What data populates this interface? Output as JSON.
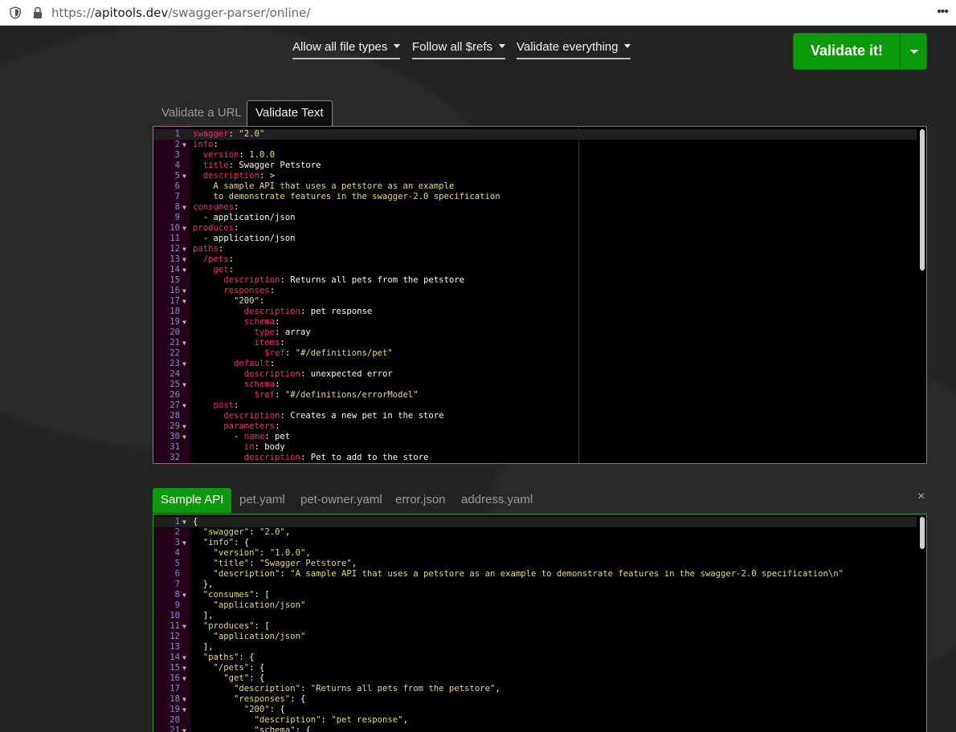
{
  "browser": {
    "url_scheme": "https://",
    "url_host": "apitools.dev",
    "url_path": "/swagger-parser/online/"
  },
  "options": {
    "file_types": "Allow all file types",
    "refs": "Follow all $refs",
    "validate": "Validate everything"
  },
  "validate_button": "Validate it!",
  "input_tabs": [
    "Validate a URL",
    "Validate Text"
  ],
  "output_tabs": [
    "Sample API",
    "pet.yaml",
    "pet-owner.yaml",
    "error.json",
    "address.yaml"
  ],
  "close_symbol": "×",
  "colors": {
    "accent_green": "#0d9a0d",
    "gutter": "#26001a",
    "key": "#f92672",
    "string": "#e6db74"
  },
  "yaml_lines": [
    {
      "n": "1",
      "fold": false,
      "segs": [
        [
          "k",
          "swagger"
        ],
        [
          "t",
          ": "
        ],
        [
          "s",
          "\"2.0\""
        ]
      ]
    },
    {
      "n": "2",
      "fold": true,
      "segs": [
        [
          "k",
          "info"
        ],
        [
          "t",
          ":"
        ]
      ]
    },
    {
      "n": "3",
      "fold": false,
      "segs": [
        [
          "t",
          "  "
        ],
        [
          "k",
          "version"
        ],
        [
          "t",
          ": "
        ],
        [
          "s",
          "1.0.0"
        ]
      ]
    },
    {
      "n": "4",
      "fold": false,
      "segs": [
        [
          "t",
          "  "
        ],
        [
          "k",
          "title"
        ],
        [
          "t",
          ": Swagger Petstore"
        ]
      ]
    },
    {
      "n": "5",
      "fold": true,
      "segs": [
        [
          "t",
          "  "
        ],
        [
          "k",
          "description"
        ],
        [
          "t",
          ": >"
        ]
      ]
    },
    {
      "n": "6",
      "fold": false,
      "segs": [
        [
          "s",
          "    A sample API that uses a petstore as an example"
        ]
      ]
    },
    {
      "n": "7",
      "fold": false,
      "segs": [
        [
          "s",
          "    to demonstrate features in the swagger-2.0 specification"
        ]
      ]
    },
    {
      "n": "8",
      "fold": true,
      "segs": [
        [
          "k",
          "consumes"
        ],
        [
          "t",
          ":"
        ]
      ]
    },
    {
      "n": "9",
      "fold": false,
      "segs": [
        [
          "t",
          "  - application/json"
        ]
      ]
    },
    {
      "n": "10",
      "fold": true,
      "segs": [
        [
          "k",
          "produces"
        ],
        [
          "t",
          ":"
        ]
      ]
    },
    {
      "n": "11",
      "fold": false,
      "segs": [
        [
          "t",
          "  - application/json"
        ]
      ]
    },
    {
      "n": "12",
      "fold": true,
      "segs": [
        [
          "k",
          "paths"
        ],
        [
          "t",
          ":"
        ]
      ]
    },
    {
      "n": "13",
      "fold": true,
      "segs": [
        [
          "t",
          "  "
        ],
        [
          "k",
          "/pets"
        ],
        [
          "t",
          ":"
        ]
      ]
    },
    {
      "n": "14",
      "fold": true,
      "segs": [
        [
          "t",
          "    "
        ],
        [
          "k",
          "get"
        ],
        [
          "t",
          ":"
        ]
      ]
    },
    {
      "n": "15",
      "fold": false,
      "segs": [
        [
          "t",
          "      "
        ],
        [
          "k",
          "description"
        ],
        [
          "t",
          ": Returns all pets from the petstore"
        ]
      ]
    },
    {
      "n": "16",
      "fold": true,
      "segs": [
        [
          "t",
          "      "
        ],
        [
          "k",
          "responses"
        ],
        [
          "t",
          ":"
        ]
      ]
    },
    {
      "n": "17",
      "fold": true,
      "segs": [
        [
          "t",
          "        "
        ],
        [
          "s",
          "\"200\""
        ],
        [
          "t",
          ":"
        ]
      ]
    },
    {
      "n": "18",
      "fold": false,
      "segs": [
        [
          "t",
          "          "
        ],
        [
          "k",
          "description"
        ],
        [
          "t",
          ": pet response"
        ]
      ]
    },
    {
      "n": "19",
      "fold": true,
      "segs": [
        [
          "t",
          "          "
        ],
        [
          "k",
          "schema"
        ],
        [
          "t",
          ":"
        ]
      ]
    },
    {
      "n": "20",
      "fold": false,
      "segs": [
        [
          "t",
          "            "
        ],
        [
          "k",
          "type"
        ],
        [
          "t",
          ": array"
        ]
      ]
    },
    {
      "n": "21",
      "fold": true,
      "segs": [
        [
          "t",
          "            "
        ],
        [
          "k",
          "items"
        ],
        [
          "t",
          ":"
        ]
      ]
    },
    {
      "n": "22",
      "fold": false,
      "segs": [
        [
          "t",
          "              "
        ],
        [
          "k",
          "$ref"
        ],
        [
          "t",
          ": "
        ],
        [
          "s",
          "\"#/definitions/pet\""
        ]
      ]
    },
    {
      "n": "23",
      "fold": true,
      "segs": [
        [
          "t",
          "        "
        ],
        [
          "k",
          "default"
        ],
        [
          "t",
          ":"
        ]
      ]
    },
    {
      "n": "24",
      "fold": false,
      "segs": [
        [
          "t",
          "          "
        ],
        [
          "k",
          "description"
        ],
        [
          "t",
          ": unexpected error"
        ]
      ]
    },
    {
      "n": "25",
      "fold": true,
      "segs": [
        [
          "t",
          "          "
        ],
        [
          "k",
          "schema"
        ],
        [
          "t",
          ":"
        ]
      ]
    },
    {
      "n": "26",
      "fold": false,
      "segs": [
        [
          "t",
          "            "
        ],
        [
          "k",
          "$ref"
        ],
        [
          "t",
          ": "
        ],
        [
          "s",
          "\"#/definitions/errorModel\""
        ]
      ]
    },
    {
      "n": "27",
      "fold": true,
      "segs": [
        [
          "t",
          "    "
        ],
        [
          "k",
          "post"
        ],
        [
          "t",
          ":"
        ]
      ]
    },
    {
      "n": "28",
      "fold": false,
      "segs": [
        [
          "t",
          "      "
        ],
        [
          "k",
          "description"
        ],
        [
          "t",
          ": Creates a new pet in the store"
        ]
      ]
    },
    {
      "n": "29",
      "fold": true,
      "segs": [
        [
          "t",
          "      "
        ],
        [
          "k",
          "parameters"
        ],
        [
          "t",
          ":"
        ]
      ]
    },
    {
      "n": "30",
      "fold": true,
      "segs": [
        [
          "t",
          "        - "
        ],
        [
          "k",
          "name"
        ],
        [
          "t",
          ": pet"
        ]
      ]
    },
    {
      "n": "31",
      "fold": false,
      "segs": [
        [
          "t",
          "          "
        ],
        [
          "k",
          "in"
        ],
        [
          "t",
          ": body"
        ]
      ]
    },
    {
      "n": "32",
      "fold": false,
      "segs": [
        [
          "t",
          "          "
        ],
        [
          "k",
          "description"
        ],
        [
          "t",
          ": Pet to add to the store"
        ]
      ]
    }
  ],
  "json_lines": [
    {
      "n": "1",
      "fold": true,
      "segs": [
        [
          "j",
          "{"
        ]
      ]
    },
    {
      "n": "2",
      "fold": false,
      "segs": [
        [
          "t",
          "  "
        ],
        [
          "s",
          "\"swagger\""
        ],
        [
          "j",
          ": "
        ],
        [
          "s",
          "\"2.0\""
        ],
        [
          "j",
          ","
        ]
      ]
    },
    {
      "n": "3",
      "fold": true,
      "segs": [
        [
          "t",
          "  "
        ],
        [
          "s",
          "\"info\""
        ],
        [
          "j",
          ": {"
        ]
      ]
    },
    {
      "n": "4",
      "fold": false,
      "segs": [
        [
          "t",
          "    "
        ],
        [
          "s",
          "\"version\""
        ],
        [
          "j",
          ": "
        ],
        [
          "s",
          "\"1.0.0\""
        ],
        [
          "j",
          ","
        ]
      ]
    },
    {
      "n": "5",
      "fold": false,
      "segs": [
        [
          "t",
          "    "
        ],
        [
          "s",
          "\"title\""
        ],
        [
          "j",
          ": "
        ],
        [
          "s",
          "\"Swagger Petstore\""
        ],
        [
          "j",
          ","
        ]
      ]
    },
    {
      "n": "6",
      "fold": false,
      "segs": [
        [
          "t",
          "    "
        ],
        [
          "s",
          "\"description\""
        ],
        [
          "j",
          ": "
        ],
        [
          "s",
          "\"A sample API that uses a petstore as an example to demonstrate features in the swagger-2.0 specification\\n\""
        ]
      ]
    },
    {
      "n": "7",
      "fold": false,
      "segs": [
        [
          "j",
          "  },"
        ]
      ]
    },
    {
      "n": "8",
      "fold": true,
      "segs": [
        [
          "t",
          "  "
        ],
        [
          "s",
          "\"consumes\""
        ],
        [
          "j",
          ": ["
        ]
      ]
    },
    {
      "n": "9",
      "fold": false,
      "segs": [
        [
          "t",
          "    "
        ],
        [
          "s",
          "\"application/json\""
        ]
      ]
    },
    {
      "n": "10",
      "fold": false,
      "segs": [
        [
          "j",
          "  ],"
        ]
      ]
    },
    {
      "n": "11",
      "fold": true,
      "segs": [
        [
          "t",
          "  "
        ],
        [
          "s",
          "\"produces\""
        ],
        [
          "j",
          ": ["
        ]
      ]
    },
    {
      "n": "12",
      "fold": false,
      "segs": [
        [
          "t",
          "    "
        ],
        [
          "s",
          "\"application/json\""
        ]
      ]
    },
    {
      "n": "13",
      "fold": false,
      "segs": [
        [
          "j",
          "  ],"
        ]
      ]
    },
    {
      "n": "14",
      "fold": true,
      "segs": [
        [
          "t",
          "  "
        ],
        [
          "s",
          "\"paths\""
        ],
        [
          "j",
          ": {"
        ]
      ]
    },
    {
      "n": "15",
      "fold": true,
      "segs": [
        [
          "t",
          "    "
        ],
        [
          "s",
          "\"/pets\""
        ],
        [
          "j",
          ": {"
        ]
      ]
    },
    {
      "n": "16",
      "fold": true,
      "segs": [
        [
          "t",
          "      "
        ],
        [
          "s",
          "\"get\""
        ],
        [
          "j",
          ": {"
        ]
      ]
    },
    {
      "n": "17",
      "fold": false,
      "segs": [
        [
          "t",
          "        "
        ],
        [
          "s",
          "\"description\""
        ],
        [
          "j",
          ": "
        ],
        [
          "s",
          "\"Returns all pets from the petstore\""
        ],
        [
          "j",
          ","
        ]
      ]
    },
    {
      "n": "18",
      "fold": true,
      "segs": [
        [
          "t",
          "        "
        ],
        [
          "s",
          "\"responses\""
        ],
        [
          "j",
          ": {"
        ]
      ]
    },
    {
      "n": "19",
      "fold": true,
      "segs": [
        [
          "t",
          "          "
        ],
        [
          "s",
          "\"200\""
        ],
        [
          "j",
          ": {"
        ]
      ]
    },
    {
      "n": "20",
      "fold": false,
      "segs": [
        [
          "t",
          "            "
        ],
        [
          "s",
          "\"description\""
        ],
        [
          "j",
          ": "
        ],
        [
          "s",
          "\"pet response\""
        ],
        [
          "j",
          ","
        ]
      ]
    },
    {
      "n": "21",
      "fold": true,
      "segs": [
        [
          "t",
          "            "
        ],
        [
          "s",
          "\"schema\""
        ],
        [
          "j",
          ": {"
        ]
      ]
    }
  ]
}
